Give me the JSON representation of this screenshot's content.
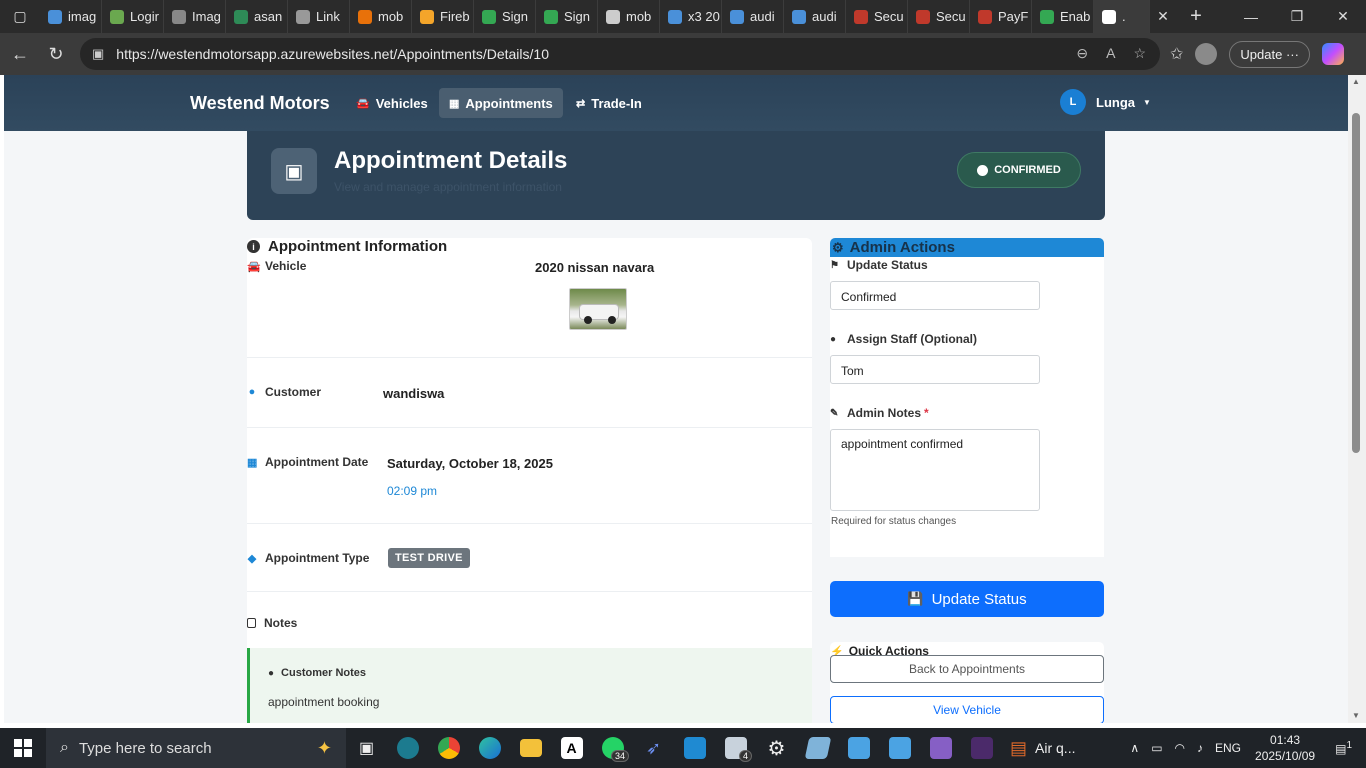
{
  "browser": {
    "tabs": [
      {
        "label": "imag",
        "color": "#4a90d9"
      },
      {
        "label": "Logir",
        "color": "#6aa84f"
      },
      {
        "label": "Imag",
        "color": "#888888"
      },
      {
        "label": "asan",
        "color": "#2e8b57"
      },
      {
        "label": "Link",
        "color": "#999999"
      },
      {
        "label": "mob",
        "color": "#e8710a"
      },
      {
        "label": "Fireb",
        "color": "#f4a52a"
      },
      {
        "label": "Sign",
        "color": "#34a853"
      },
      {
        "label": "Sign",
        "color": "#34a853"
      },
      {
        "label": "mob",
        "color": "#cccccc"
      },
      {
        "label": "x3 20",
        "color": "#4a90d9"
      },
      {
        "label": "audi",
        "color": "#4a90d9"
      },
      {
        "label": "audi",
        "color": "#4a90d9"
      },
      {
        "label": "Secu",
        "color": "#c0392b"
      },
      {
        "label": "Secu",
        "color": "#c0392b"
      },
      {
        "label": "PayF",
        "color": "#c0392b"
      },
      {
        "label": "Enab",
        "color": "#34a853"
      }
    ],
    "url": "https://westendmotorsapp.azurewebsites.net/Appointments/Details/10",
    "update_label": "Update"
  },
  "nav": {
    "brand": "Westend Motors",
    "vehicles": "Vehicles",
    "appointments": "Appointments",
    "tradein": "Trade-In",
    "user_initial": "L",
    "user_name": "Lunga"
  },
  "header": {
    "title": "Appointment Details",
    "subtitle": "View and manage appointment information",
    "status": "CONFIRMED"
  },
  "info": {
    "title": "Appointment Information",
    "vehicle_label": "Vehicle",
    "vehicle_value": "2020 nissan navara",
    "customer_label": "Customer",
    "customer_value": "wandiswa",
    "date_label": "Appointment Date",
    "date_value": "Saturday, October 18, 2025",
    "time_value": "02:09 pm",
    "type_label": "Appointment Type",
    "type_value": "TEST DRIVE",
    "notes_title": "Notes",
    "customer_notes_label": "Customer Notes",
    "customer_notes_value": "appointment booking"
  },
  "admin": {
    "title": "Admin Actions",
    "status_label": "Update Status",
    "status_value": "Confirmed",
    "staff_label": "Assign Staff (Optional)",
    "staff_value": "Tom",
    "notes_label": "Admin Notes",
    "required_mark": "*",
    "notes_value": "appointment confirmed",
    "helper": "Required for status changes",
    "update_button": "Update Status",
    "quick_title": "Quick Actions",
    "back_button": "Back to Appointments",
    "view_button": "View Vehicle"
  },
  "taskbar": {
    "search_placeholder": "Type here to search",
    "whatsapp_count": "34",
    "mail_count": "4",
    "weather": "Air q...",
    "lang": "ENG",
    "time": "01:43",
    "date": "2025/10/09",
    "notif_count": "1"
  }
}
